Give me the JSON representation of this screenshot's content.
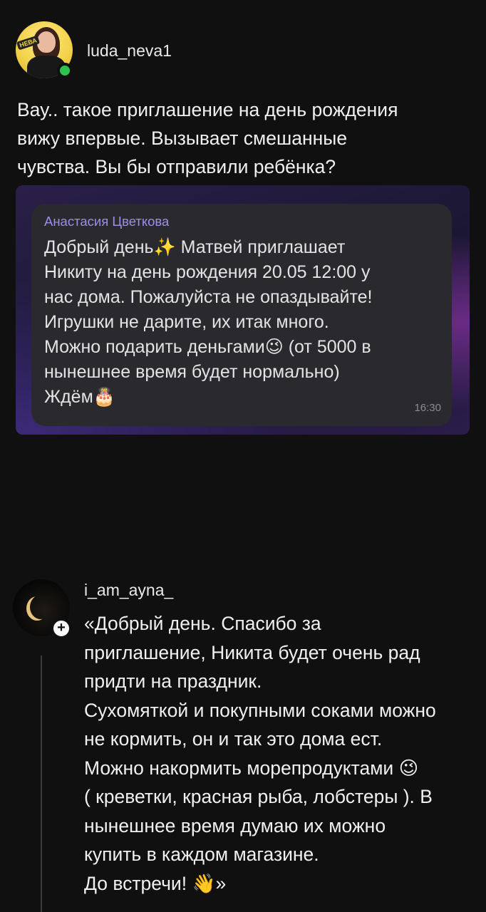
{
  "post": {
    "author": "luda_neva1",
    "avatar_badge": "НЕВА",
    "text_lines": [
      "Вау.. такое приглашение на день рождения",
      "вижу впервые. Вызывает смешанные",
      "чувства. Вы бы отправили ребёнка?"
    ],
    "screenshot": {
      "sender": "Анастасия Цветкова",
      "message_lines": [
        "Добрый день✨ Матвей приглашает",
        "Никиту на день  рождения 20.05 12:00 у",
        "нас дома. Пожалуйста не опаздывайте!",
        "Игрушки не дарите, их итак много.",
        "Можно подарить деньгами😉 (от 5000 в",
        "нынешнее время будет нормально)",
        "Ждём🎂"
      ],
      "time": "16:30"
    }
  },
  "reply": {
    "author": "i_am_ayna_",
    "plus_icon": "+",
    "text_lines": [
      "«Добрый день. Спасибо за",
      "приглашение, Никита будет очень рад",
      "придти на праздник.",
      "Сухомяткой и покупными соками можно",
      "не кормить, он и так это дома ест.",
      "Можно накормить морепродуктами 😉",
      "( креветки, красная рыба, лобстеры ). В",
      "нынешнее время думаю их можно",
      "купить в каждом магазине.",
      "До встречи! 👋»"
    ]
  },
  "colors": {
    "background": "#101010",
    "online": "#2ec24f",
    "sender_name": "#9b8fe6",
    "bubble": "#2a2a2e"
  }
}
